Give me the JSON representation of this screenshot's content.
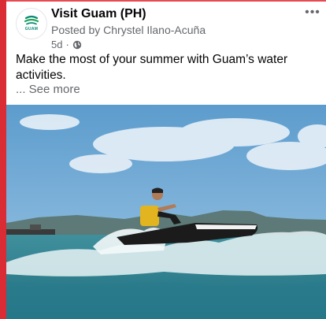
{
  "post": {
    "page_name": "Visit Guam (PH)",
    "posted_by": "Posted by Chrystel Ilano-Acuña",
    "time": "5d",
    "separator": "·",
    "privacy_icon": "globe-icon",
    "more_icon": "more-horizontal-icon",
    "more_label": "•••",
    "text": "Make the most of your summer with Guam’s water activities.",
    "see_more": "... See more",
    "avatar_logo_text": "GUAM"
  },
  "colors": {
    "background": "#d92c35",
    "card": "#ffffff",
    "primary_text": "#050505",
    "secondary_text": "#65676b",
    "logo": "#0b8b76"
  }
}
